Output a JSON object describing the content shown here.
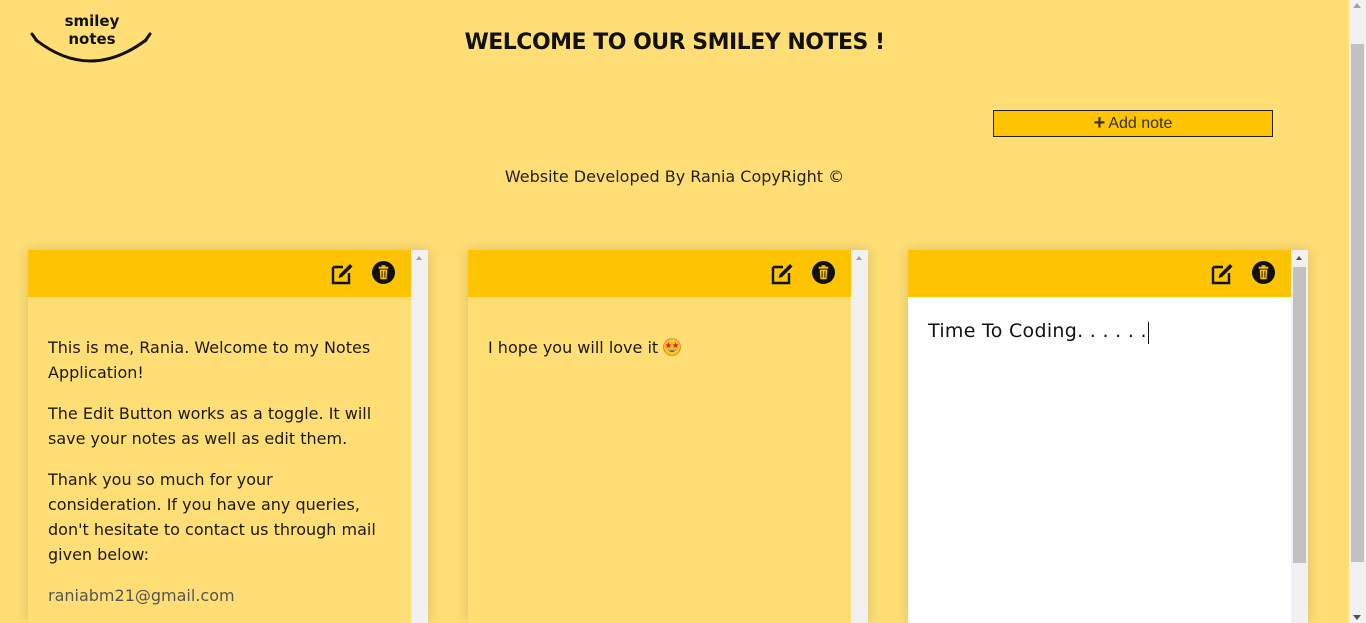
{
  "logo": {
    "line1": "smiley",
    "line2": "notes"
  },
  "title": "WELCOME TO OUR SMILEY NOTES !",
  "add_button": {
    "icon": "plus-icon",
    "label": "Add note"
  },
  "footer": "Website Developed By Rania CopyRight ©",
  "colors": {
    "background": "#ffde75",
    "accent": "#fec402",
    "editor_bg": "#ffffff"
  },
  "notes": [
    {
      "icons": [
        "edit-icon",
        "trash-icon"
      ],
      "paragraphs": [
        "This is me, Rania. Welcome to my Notes Application!",
        "The Edit Button works as a toggle. It will save your notes as well as edit them.",
        "Thank you so much for your consideration. If you have any queries, don't hesitate to contact us through mail given below:"
      ],
      "email": "raniabm21@gmail.com"
    },
    {
      "icons": [
        "edit-icon",
        "trash-icon"
      ],
      "text": "I hope you will love it",
      "emoji": "star-struck-emoji"
    },
    {
      "icons": [
        "edit-icon",
        "trash-icon"
      ],
      "editor_value": "Time To Coding. . . . . ."
    }
  ]
}
